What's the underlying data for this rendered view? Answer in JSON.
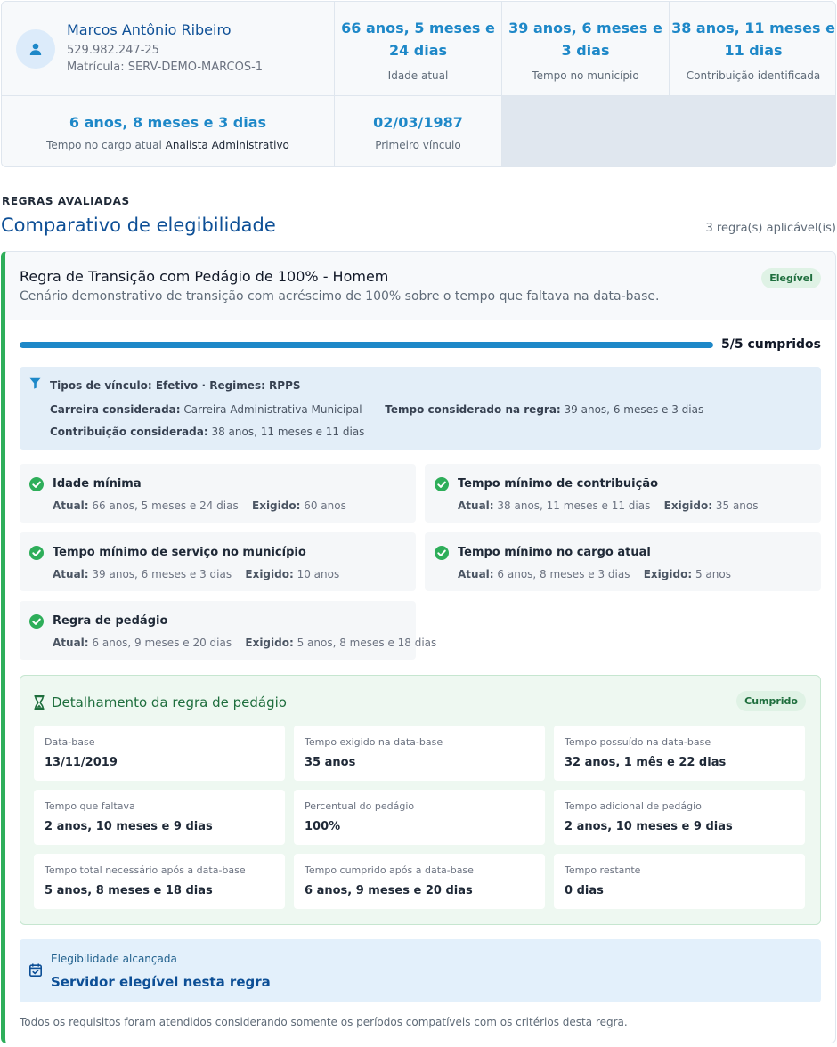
{
  "profile": {
    "name": "Marcos Antônio Ribeiro",
    "cpf": "529.982.247-25",
    "matricula": "Matrícula: SERV-DEMO-MARCOS-1"
  },
  "stats": {
    "age": {
      "value": "66 anos, 5 meses e 24 dias",
      "label": "Idade atual"
    },
    "municipio": {
      "value": "39 anos, 6 meses e 3 dias",
      "label": "Tempo no município"
    },
    "contribuicao": {
      "value": "38 anos, 11 meses e 11 dias",
      "label": "Contribuição identificada"
    },
    "cargo": {
      "value": "6 anos, 8 meses e 3 dias",
      "label": "Tempo no cargo atual",
      "cargo_name": "Analista Administrativo"
    },
    "primeiro_vinculo": {
      "value": "02/03/1987",
      "label": "Primeiro vínculo"
    }
  },
  "section": {
    "eyebrow": "REGRAS AVALIADAS",
    "title": "Comparativo de elegibilidade",
    "count": "3 regra(s) aplicável(is)"
  },
  "rule": {
    "title": "Regra de Transição com Pedágio de 100% - Homem",
    "description": "Cenário demonstrativo de transição com acréscimo de 100% sobre o tempo que faltava na data-base.",
    "badge": "Elegível",
    "progress_fraction": 1.0,
    "progress_label": "5/5 cumpridos",
    "filters": {
      "line1": "Tipos de vínculo: Efetivo · Regimes: RPPS",
      "carreira_label": "Carreira considerada:",
      "carreira_value": "Carreira Administrativa Municipal",
      "tempo_label": "Tempo considerado na regra:",
      "tempo_value": "39 anos, 6 meses e 3 dias",
      "contribuicao_label": "Contribuição considerada:",
      "contribuicao_value": "38 anos, 11 meses e 11 dias"
    },
    "atual_label": "Atual:",
    "exigido_label": "Exigido:",
    "requirements": [
      {
        "title": "Idade mínima",
        "atual": "66 anos, 5 meses e 24 dias",
        "exigido": "60 anos"
      },
      {
        "title": "Tempo mínimo de contribuição",
        "atual": "38 anos, 11 meses e 11 dias",
        "exigido": "35 anos"
      },
      {
        "title": "Tempo mínimo de serviço no município",
        "atual": "39 anos, 6 meses e 3 dias",
        "exigido": "10 anos"
      },
      {
        "title": "Tempo mínimo no cargo atual",
        "atual": "6 anos, 8 meses e 3 dias",
        "exigido": "5 anos"
      },
      {
        "title": "Regra de pedágio",
        "atual": "6 anos, 9 meses e 20 dias",
        "exigido": "5 anos, 8 meses e 18 dias"
      }
    ],
    "toll": {
      "title": "Detalhamento da regra de pedágio",
      "badge": "Cumprido",
      "cells": [
        {
          "label": "Data-base",
          "value": "13/11/2019"
        },
        {
          "label": "Tempo exigido na data-base",
          "value": "35 anos"
        },
        {
          "label": "Tempo possuído na data-base",
          "value": "32 anos, 1 mês e 22 dias"
        },
        {
          "label": "Tempo que faltava",
          "value": "2 anos, 10 meses e 9 dias"
        },
        {
          "label": "Percentual do pedágio",
          "value": "100%"
        },
        {
          "label": "Tempo adicional de pedágio",
          "value": "2 anos, 10 meses e 9 dias"
        },
        {
          "label": "Tempo total necessário após a data-base",
          "value": "5 anos, 8 meses e 18 dias"
        },
        {
          "label": "Tempo cumprido após a data-base",
          "value": "6 anos, 9 meses e 20 dias"
        },
        {
          "label": "Tempo restante",
          "value": "0 dias"
        }
      ]
    },
    "eligibility": {
      "label": "Elegibilidade alcançada",
      "value": "Servidor elegível nesta regra"
    },
    "footnote": "Todos os requisitos foram atendidos considerando somente os períodos compatíveis com os critérios desta regra."
  },
  "colors": {
    "primary": "#0d4f96",
    "accent": "#1e88c8",
    "success": "#2eae5a",
    "success_dark": "#1e6e3d"
  },
  "icons": {
    "avatar": "user-icon",
    "filter": "filter-icon",
    "check": "check-circle-icon",
    "toll": "hourglass-icon",
    "eligibility": "calendar-check-icon"
  }
}
